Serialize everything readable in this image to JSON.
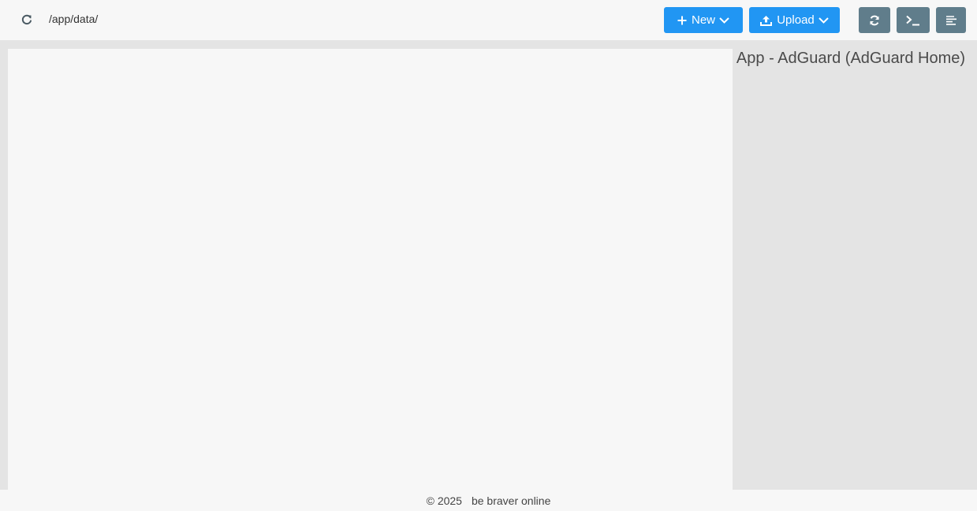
{
  "toolbar": {
    "refresh_icon": "refresh-icon",
    "path": "/app/data/",
    "new_label": "New",
    "upload_label": "Upload",
    "sync_icon": "sync-icon",
    "terminal_icon": "terminal-icon",
    "menu_icon": "menu-lines-icon"
  },
  "side_panel": {
    "title": "App - AdGuard (AdGuard Home)"
  },
  "footer": {
    "copyright": "© 2025",
    "site": "be braver online"
  },
  "colors": {
    "primary": "#2196f3",
    "dark_button": "#607d8b",
    "panel_bg": "#f7f7f7",
    "page_bg": "#e4e4e4"
  }
}
